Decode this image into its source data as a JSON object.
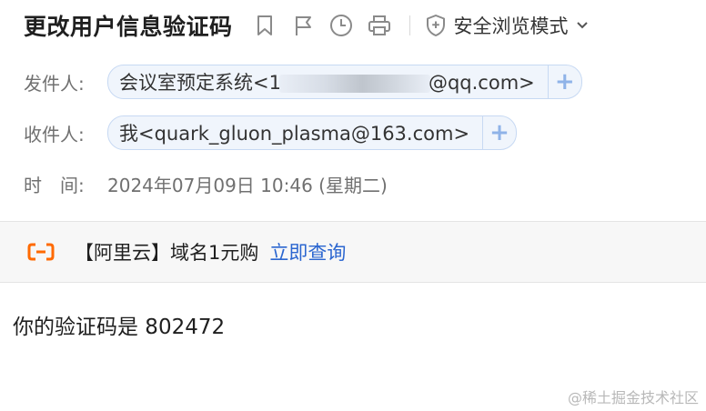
{
  "subject": "更改用户信息验证码",
  "toolbar": {
    "bookmark_icon": "bookmark-icon",
    "flag_icon": "flag-icon",
    "clock_icon": "clock-icon",
    "print_icon": "print-icon",
    "safe_mode_label": "安全浏览模式"
  },
  "sender": {
    "label": "发件人:",
    "name": "会议室预定系统",
    "addr_prefix": "<1",
    "addr_suffix": "@qq.com>"
  },
  "recipient": {
    "label": "收件人:",
    "display": "我<quark_gluon_plasma@163.com>"
  },
  "time": {
    "label": "时　间:",
    "value": "2024年07月09日 10:46 (星期二)"
  },
  "ad": {
    "text": "【阿里云】域名1元购",
    "link": "立即查询",
    "logo_color": "#ff6a00"
  },
  "body": {
    "content": "你的验证码是 802472"
  },
  "watermark": "@稀土掘金技术社区",
  "colors": {
    "accent": "#2b66d0",
    "chip_bg": "#f0f5fc",
    "chip_border": "#c7d9f3"
  }
}
